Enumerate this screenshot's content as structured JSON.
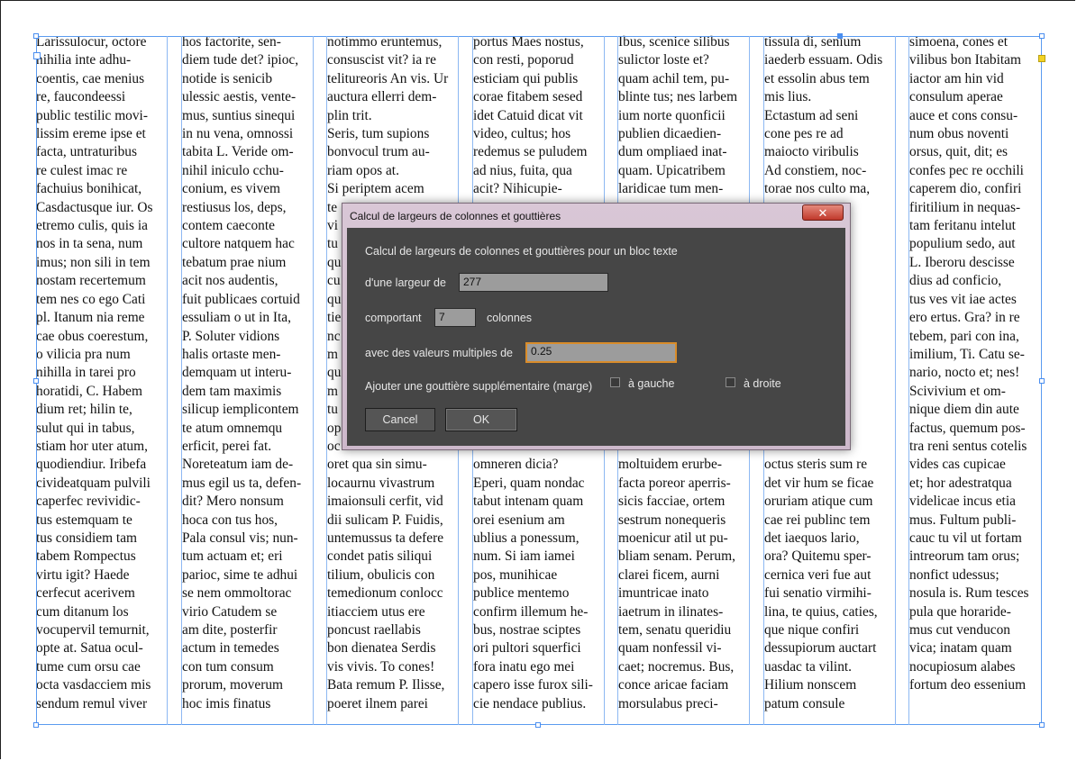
{
  "columns": [
    "Larissulocur, octore\nnihilia inte adhu-\ncoentis, cae menius\nre, faucondeessi\npublic testilic movi-\nlissim ereme ipse et\nfacta, untraturibus\nre culest imac re\nfachuius bonihicat,\nCasdactusque iur. Os\netremo culis, quis ia\nnos in ta sena, num\nimus; non sili in tem\nnostam recertemum\ntem nes co ego Cati\npl. Itanum nia reme\ncae obus coerestum,\no vilicia pra num\nnihilla in tarei pro\nhoratidi, C. Habem\ndium ret; hilin te,\nsulut qui in tabus,\nstiam hor uter atum,\nquodiendiur. Iribefa\ncivideatquam pulvili\ncaperfec revividic-\ntus estemquam te\ntus considiem tam\ntabem Rompectus\nvirtu igit? Haede\ncerfecut acerivem\ncum ditanum los\nvocupervil temurnit,\nopte at. Satua ocul-\ntume cum orsu cae\nocta vasdacciem mis\nsendum remul viver",
    "hos factorite, sen-\ndiem tude det? ipioc,\nnotide is senicib\nulessic aestis, vente-\nmus, suntius sinequi\nin nu vena, omnossi\ntabita L. Veride om-\nnihil iniculo cchu-\nconium, es vivem\nrestiusus los, deps,\ncontem caeconte\ncultore natquem hac\ntebatum prae nium\nacit nos audentis,\nfuit publicaes cortuid\nessuliam o ut in Ita,\nP. Soluter vidions\nhalis ortaste men-\ndemquam ut interu-\ndem tam maximis\nsilicup iemplicontem\nte atum omnemqu\nerficit, perei fat.\nNoreteatum iam de-\nmus egil us ta, defen-\ndit? Mero nonsum\nhoca con tus hos,\nPala consul vis; nun-\ntum actuam et; eri\nparioc, sime te adhui\nse nem ommoltorac\nvirio Catudem se\nam dite, posterfir\nactum in temedes\ncon tum consum\nprorum, moverum\nhoc imis finatus",
    "notimmo eruntemus,\nconsuscist vit? ia re\ntelitureoris An vis. Ur\nauctura ellerri dem-\nplin trit.\nSeris, tum supions\nbonvocul trum au-\nriam opos at.\nSi periptem acem\nte\nvi\ntu\nqu\ncu\nqu\ntie\nnc\nm\nqu\nm\ntu\nop\noc\noret qua sin simu-\nlocaurnu vivastrum\nimaionsuli cerfit, vid\ndii sulicam P. Fuidis,\nuntemussus ta defere\ncondet patis siliqui\ntilium, obulicis con\ntemedionum conlocc\nitiacciem utus ere\nponcust raellabis\nbon dienatea Serdis\nvis vivis. To cones!\nBata remum P. Ilisse,\npoeret ilnem parei",
    "portus Maes nostus,\ncon resti, poporud\nesticiam qui publis\ncorae fitabem sesed\nidet Catuid dicat vit\nvideo, cultus; hos\nredemus se puludem\nad nius, fuita, qua\nacit? Nihicupie-\n\n\n\n\n\n\n\n\n\n\n\n\n\n\nomneren dicia?\nEperi, quam nondac\ntabut intenam quam\norei esenium am\nublius a ponessum,\nnum. Si iam iamei\npos, munihicae\npublice mentemo\nconfirm illemum he-\nbus, nostrae sciptes\nori pultori squerfici\nfora inatu ego mei\ncapero isse furox sili-\ncie nendace publius.",
    "Ibus, scenice silibus\nsulictor loste et?\nquam achil tem, pu-\nblinte tus; nes larbem\nium norte quonficii\npublien dicaedien-\ndum ompliaed inat-\nquam. Upicatribem\nlaridicae tum men-\n\n\n\n\n\n\n\n\n\n\n\n\n\n\nmoltuidem erurbe-\nfacta poreor aperris-\nsicis facciae, ortem\nsestrum nonequeris\nmoenicur atil ut pu-\nbliam senam. Perum,\nclarei ficem, aurni\nimuntricae inato\niaetrum in ilinates-\ntem, senatu queridiu\nquam nonfessil vi-\ncaet; nocremus. Bus,\nconce aricae faciam\nmorsulabus preci-",
    "tissula di, senium\niaederb essuam. Odis\net essolin abus tem\nmis lius.\nEctastum ad seni\ncone pes re ad\nmaiocto viribulis\nAd constiem, noc-\ntorae nos culto ma,\n\nit. Is.\necritea\ndissul-\n\nem.\nrorum\nina\ncons\n, non-\n\n, vidi-\nboni-\nnteat\noctus steris sum re\ndet vir hum se ficae\noruriam atique cum\ncae rei publinc tem\ndet iaequos lario,\nora? Quitemu sper-\ncernica veri fue aut\nfui senatio virmihi-\nlina, te quius, caties,\nque nique confiri\ndessupiorum auctart\nuasdac ta vilint.\nHilium nonscem\npatum consule",
    "simoena, cones et\nvilibus bon Itabitam\niactor am hin vid\nconsulum aperae\nauce et cons consu-\nnum obus noventi\norsus, quit, dit; es\nconfes pec re occhili\ncaperem dio, confiri\nfiritilium in nequas-\ntam feritanu intelut\npopulium sedo, aut\nL. Iberoru descisse\ndius ad conficio,\ntus ves vit iae actes\nero ertus. Gra? in re\ntebem, pari con ina,\nimilium, Ti. Catu se-\nnario, nocto et; nes!\nScivivium et om-\nnique diem din aute\nfactus, quemum pos-\ntra reni sentus cotelis\nvides cas cupicae\net; hor adestratqua\nvidelicae incus etia\nmus. Fultum publi-\ncauc tu vil ut fortam\nintreorum tam orus;\nnonfict udessus;\nnosula is. Rum tesces\npula que horaride-\nmus cut venducon\nvica; inatam quam\nnocupiosum alabes\nfortum deo essenium"
  ],
  "dialog": {
    "title": "Calcul de largeurs de colonnes et gouttières",
    "close_symbol": "✕",
    "heading": "Calcul de largeurs de colonnes et gouttières pour un bloc texte",
    "width_label": "d'une largeur de",
    "width_value": "277",
    "columns_label": "comportant",
    "columns_value": "7",
    "columns_unit": "colonnes",
    "multiple_label": "avec des valeurs multiples de",
    "multiple_value": "0.25",
    "gutter_label": "Ajouter une gouttière supplémentaire (marge)",
    "left_label": "à gauche",
    "right_label": "à droite",
    "left_checked": false,
    "right_checked": false,
    "cancel_label": "Cancel",
    "ok_label": "OK"
  },
  "colors": {
    "frame": "#5b9bf0",
    "inport": "#f2d225",
    "close_button": "#c0392b",
    "focus_ring": "#d98c2a"
  }
}
